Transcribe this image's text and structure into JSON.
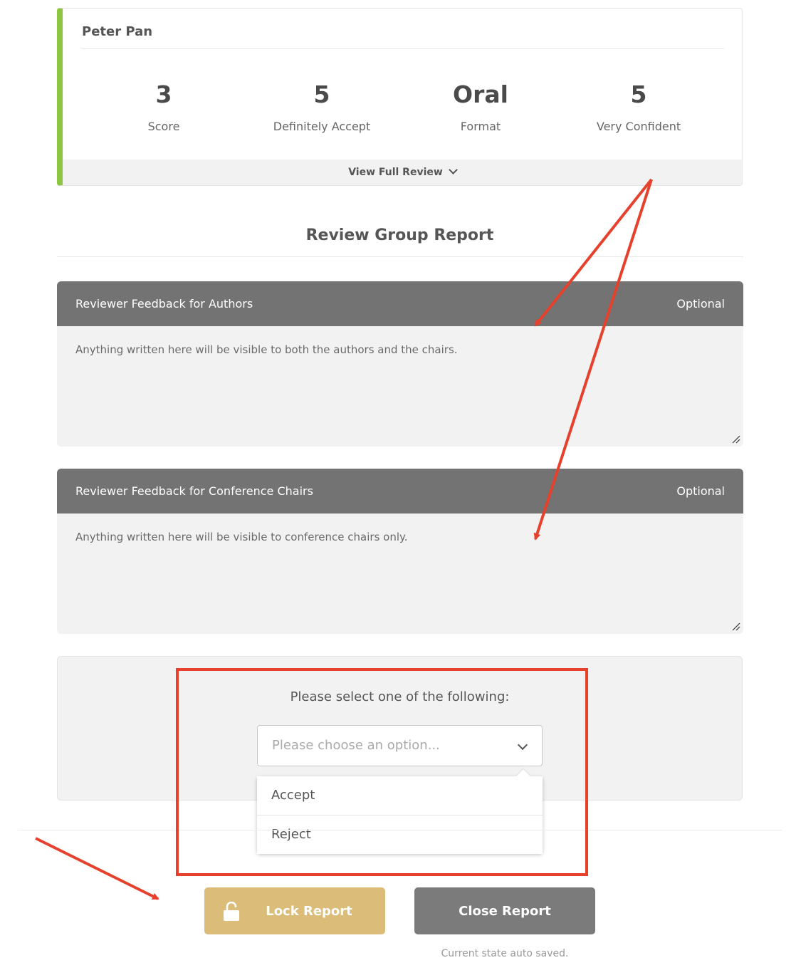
{
  "review": {
    "reviewer": "Peter Pan",
    "stats": [
      {
        "value": "3",
        "label": "Score"
      },
      {
        "value": "5",
        "label": "Definitely Accept"
      },
      {
        "value": "Oral",
        "label": "Format"
      },
      {
        "value": "5",
        "label": "Very Confident"
      }
    ],
    "view_full_label": "View Full Review"
  },
  "report": {
    "title": "Review Group Report",
    "authors_panel": {
      "title": "Reviewer Feedback for Authors",
      "tag": "Optional",
      "placeholder": "Anything written here will be visible to both the authors and the chairs."
    },
    "chairs_panel": {
      "title": "Reviewer Feedback for Conference Chairs",
      "tag": "Optional",
      "placeholder": "Anything written here will be visible to conference chairs only."
    },
    "decision": {
      "prompt": "Please select one of the following:",
      "placeholder": "Please choose an option...",
      "options": [
        "Accept",
        "Reject"
      ]
    }
  },
  "actions": {
    "lock_label": "Lock Report",
    "close_label": "Close Report",
    "autosave_note": "Current state auto saved."
  },
  "colors": {
    "accent_green": "#8dc63f",
    "panel_header": "#737373",
    "lock_button": "#dbbc78",
    "close_button": "#7b7b7b",
    "annotation_red": "#e5412d"
  }
}
